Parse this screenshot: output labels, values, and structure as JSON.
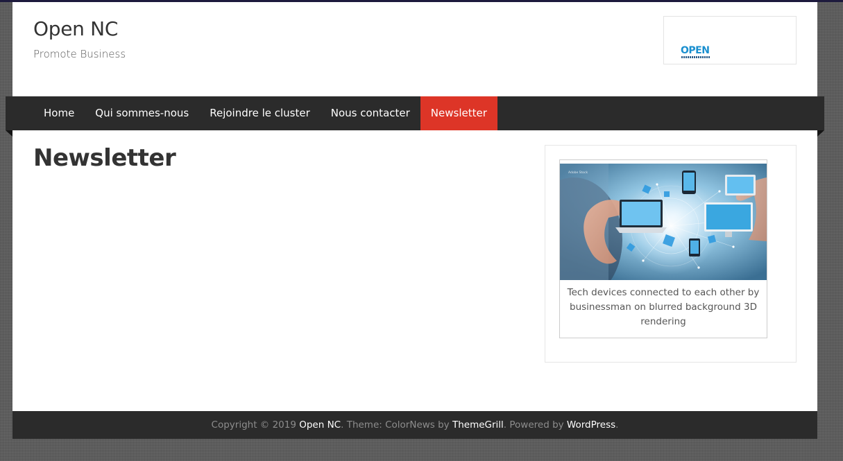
{
  "site": {
    "title": "Open NC",
    "tagline": "Promote Business",
    "logo_text": "OPEN"
  },
  "nav": {
    "items": [
      {
        "label": "Home",
        "active": false
      },
      {
        "label": "Qui sommes-nous",
        "active": false
      },
      {
        "label": "Rejoindre le cluster",
        "active": false
      },
      {
        "label": "Nous contacter",
        "active": false
      },
      {
        "label": "Newsletter",
        "active": true
      }
    ]
  },
  "main": {
    "title": "Newsletter"
  },
  "sidebar": {
    "image_caption": "Tech devices connected to each other by businessman on blurred background 3D rendering"
  },
  "footer": {
    "copyright": "Copyright © 2019 ",
    "site_link": "Open NC",
    "theme_text": ". Theme: ColorNews by ",
    "theme_link": "ThemeGrill",
    "powered_text": ". Powered by ",
    "powered_link": "WordPress",
    "end": "."
  },
  "colors": {
    "nav_background": "#2b2b2b",
    "nav_active": "#dd3527",
    "page_background": "#ffffff",
    "body_background": "#5d5d5d"
  }
}
